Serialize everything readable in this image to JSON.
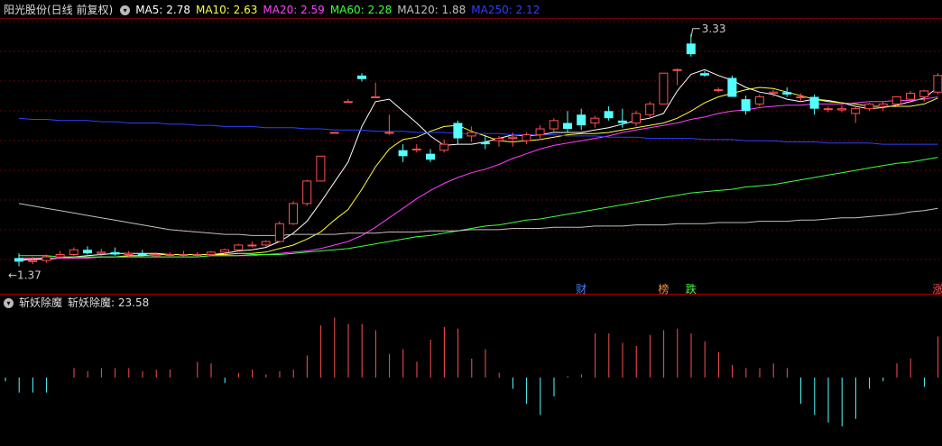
{
  "header": {
    "stock_title": "阳光股份(日线 前复权)",
    "ma5_label": "MA5: 2.78",
    "ma10_label": "MA10: 2.63",
    "ma20_label": "MA20: 2.59",
    "ma60_label": "MA60: 2.28",
    "ma120_label": "MA120: 1.88",
    "ma250_label": "MA250: 2.12"
  },
  "indicator": {
    "title": "斩妖除魔",
    "value_label": "斩妖除魔: 23.58"
  },
  "colors": {
    "background": "#000000",
    "up": "#ff5050",
    "down": "#54ffff",
    "ma5": "#ffffff",
    "ma10": "#ffff40",
    "ma20": "#ff40ff",
    "ma60": "#40ff40",
    "ma120": "#c0c0c0",
    "ma250": "#3040ff",
    "grid": "#6a0000"
  },
  "chart_data": [
    {
      "type": "candlestick",
      "title": "阳光股份(日线 前复权)",
      "ylim": [
        1.2,
        3.45
      ],
      "high_label": "3.33",
      "low_label": "1.37",
      "markers": [
        {
          "index": 41,
          "text": "财",
          "color": "#4080ff"
        },
        {
          "index": 47,
          "text": "榜",
          "color": "#ff9040"
        },
        {
          "index": 49,
          "text": "跌",
          "color": "#40ff40"
        },
        {
          "index": 67,
          "text": "涨",
          "color": "#ff5050"
        }
      ],
      "ohlc": [
        [
          1.44,
          1.48,
          1.37,
          1.41
        ],
        [
          1.41,
          1.45,
          1.39,
          1.42
        ],
        [
          1.42,
          1.47,
          1.4,
          1.45
        ],
        [
          1.45,
          1.5,
          1.43,
          1.47
        ],
        [
          1.47,
          1.53,
          1.46,
          1.51
        ],
        [
          1.51,
          1.54,
          1.47,
          1.48
        ],
        [
          1.48,
          1.52,
          1.45,
          1.49
        ],
        [
          1.49,
          1.53,
          1.46,
          1.47
        ],
        [
          1.47,
          1.5,
          1.45,
          1.48
        ],
        [
          1.48,
          1.51,
          1.46,
          1.46
        ],
        [
          1.46,
          1.49,
          1.44,
          1.47
        ],
        [
          1.47,
          1.49,
          1.45,
          1.47
        ],
        [
          1.47,
          1.5,
          1.45,
          1.47
        ],
        [
          1.47,
          1.49,
          1.45,
          1.47
        ],
        [
          1.47,
          1.5,
          1.46,
          1.49
        ],
        [
          1.49,
          1.52,
          1.47,
          1.51
        ],
        [
          1.51,
          1.56,
          1.5,
          1.55
        ],
        [
          1.55,
          1.58,
          1.53,
          1.55
        ],
        [
          1.55,
          1.59,
          1.54,
          1.58
        ],
        [
          1.58,
          1.75,
          1.57,
          1.73
        ],
        [
          1.73,
          1.92,
          1.72,
          1.9
        ],
        [
          1.9,
          2.1,
          1.88,
          2.09
        ],
        [
          2.09,
          2.3,
          2.09,
          2.3
        ],
        [
          2.5,
          2.5,
          2.5,
          2.5
        ],
        [
          2.76,
          2.78,
          2.76,
          2.76
        ],
        [
          2.98,
          3.0,
          2.93,
          2.95
        ],
        [
          2.8,
          2.92,
          2.8,
          2.8
        ],
        [
          2.5,
          2.65,
          2.48,
          2.5
        ],
        [
          2.35,
          2.4,
          2.25,
          2.3
        ],
        [
          2.36,
          2.4,
          2.33,
          2.36
        ],
        [
          2.32,
          2.36,
          2.25,
          2.27
        ],
        [
          2.35,
          2.44,
          2.33,
          2.4
        ],
        [
          2.58,
          2.6,
          2.4,
          2.45
        ],
        [
          2.47,
          2.55,
          2.42,
          2.5
        ],
        [
          2.42,
          2.48,
          2.36,
          2.4
        ],
        [
          2.43,
          2.47,
          2.38,
          2.45
        ],
        [
          2.45,
          2.5,
          2.38,
          2.46
        ],
        [
          2.43,
          2.5,
          2.4,
          2.48
        ],
        [
          2.48,
          2.56,
          2.45,
          2.53
        ],
        [
          2.53,
          2.62,
          2.5,
          2.6
        ],
        [
          2.58,
          2.68,
          2.5,
          2.53
        ],
        [
          2.65,
          2.7,
          2.52,
          2.56
        ],
        [
          2.58,
          2.64,
          2.54,
          2.62
        ],
        [
          2.68,
          2.72,
          2.6,
          2.62
        ],
        [
          2.6,
          2.7,
          2.54,
          2.58
        ],
        [
          2.58,
          2.68,
          2.55,
          2.66
        ],
        [
          2.65,
          2.76,
          2.62,
          2.74
        ],
        [
          2.74,
          3.0,
          2.74,
          3.0
        ],
        [
          3.03,
          3.04,
          2.9,
          3.03
        ],
        [
          3.25,
          3.33,
          3.14,
          3.16
        ],
        [
          3.0,
          3.02,
          2.97,
          2.98
        ],
        [
          2.86,
          2.88,
          2.84,
          2.86
        ],
        [
          2.96,
          2.98,
          2.8,
          2.8
        ],
        [
          2.78,
          2.81,
          2.65,
          2.68
        ],
        [
          2.74,
          2.82,
          2.72,
          2.8
        ],
        [
          2.83,
          2.86,
          2.8,
          2.84
        ],
        [
          2.84,
          2.88,
          2.8,
          2.82
        ],
        [
          2.8,
          2.83,
          2.76,
          2.8
        ],
        [
          2.8,
          2.82,
          2.65,
          2.7
        ],
        [
          2.7,
          2.72,
          2.67,
          2.7
        ],
        [
          2.69,
          2.73,
          2.67,
          2.7
        ],
        [
          2.66,
          2.72,
          2.58,
          2.7
        ],
        [
          2.7,
          2.75,
          2.68,
          2.74
        ],
        [
          2.72,
          2.76,
          2.68,
          2.74
        ],
        [
          2.74,
          2.8,
          2.72,
          2.8
        ],
        [
          2.78,
          2.85,
          2.75,
          2.83
        ],
        [
          2.8,
          2.86,
          2.76,
          2.85
        ],
        [
          2.84,
          3.0,
          2.82,
          2.98
        ]
      ],
      "series": [
        {
          "name": "MA5",
          "values": [
            1.42,
            1.43,
            1.43,
            1.44,
            1.45,
            1.46,
            1.47,
            1.48,
            1.48,
            1.48,
            1.48,
            1.47,
            1.47,
            1.47,
            1.47,
            1.48,
            1.5,
            1.51,
            1.53,
            1.58,
            1.65,
            1.75,
            1.91,
            2.08,
            2.25,
            2.55,
            2.76,
            2.78,
            2.68,
            2.58,
            2.47,
            2.39,
            2.4,
            2.4,
            2.42,
            2.45,
            2.48,
            2.47,
            2.48,
            2.5,
            2.5,
            2.5,
            2.52,
            2.54,
            2.57,
            2.6,
            2.62,
            2.66,
            2.85,
            2.99,
            3.03,
            2.98,
            2.94,
            2.88,
            2.84,
            2.82,
            2.78,
            2.76,
            2.78,
            2.77,
            2.75,
            2.72,
            2.7,
            2.71,
            2.73,
            2.76,
            2.79,
            2.88
          ]
        },
        {
          "name": "MA10",
          "values": [
            1.43,
            1.43,
            1.44,
            1.44,
            1.44,
            1.44,
            1.45,
            1.45,
            1.46,
            1.46,
            1.47,
            1.47,
            1.47,
            1.47,
            1.47,
            1.47,
            1.48,
            1.48,
            1.49,
            1.52,
            1.55,
            1.6,
            1.66,
            1.76,
            1.85,
            2.02,
            2.21,
            2.36,
            2.44,
            2.46,
            2.51,
            2.55,
            2.56,
            2.51,
            2.47,
            2.43,
            2.42,
            2.43,
            2.44,
            2.46,
            2.48,
            2.49,
            2.49,
            2.5,
            2.52,
            2.54,
            2.56,
            2.58,
            2.62,
            2.68,
            2.75,
            2.8,
            2.83,
            2.86,
            2.88,
            2.87,
            2.84,
            2.81,
            2.78,
            2.76,
            2.75,
            2.74,
            2.72,
            2.72,
            2.72,
            2.72,
            2.74,
            2.79
          ]
        },
        {
          "name": "MA20",
          "values": [
            1.44,
            1.44,
            1.44,
            1.44,
            1.44,
            1.44,
            1.45,
            1.45,
            1.45,
            1.45,
            1.45,
            1.45,
            1.45,
            1.45,
            1.46,
            1.46,
            1.46,
            1.46,
            1.47,
            1.48,
            1.49,
            1.5,
            1.52,
            1.55,
            1.58,
            1.63,
            1.7,
            1.78,
            1.86,
            1.94,
            2.01,
            2.07,
            2.12,
            2.16,
            2.19,
            2.23,
            2.28,
            2.32,
            2.36,
            2.39,
            2.41,
            2.43,
            2.45,
            2.47,
            2.5,
            2.52,
            2.54,
            2.56,
            2.58,
            2.61,
            2.63,
            2.66,
            2.68,
            2.69,
            2.71,
            2.72,
            2.73,
            2.73,
            2.74,
            2.74,
            2.74,
            2.75,
            2.76,
            2.76,
            2.77,
            2.77,
            2.78,
            2.8
          ]
        },
        {
          "name": "MA60",
          "values": [
            1.46,
            1.46,
            1.46,
            1.45,
            1.45,
            1.45,
            1.45,
            1.45,
            1.45,
            1.45,
            1.45,
            1.45,
            1.45,
            1.45,
            1.46,
            1.46,
            1.46,
            1.47,
            1.47,
            1.47,
            1.48,
            1.49,
            1.5,
            1.51,
            1.52,
            1.54,
            1.56,
            1.58,
            1.6,
            1.62,
            1.63,
            1.65,
            1.67,
            1.69,
            1.71,
            1.72,
            1.74,
            1.76,
            1.77,
            1.79,
            1.81,
            1.83,
            1.85,
            1.87,
            1.89,
            1.91,
            1.93,
            1.95,
            1.97,
            1.99,
            2.0,
            2.01,
            2.02,
            2.04,
            2.05,
            2.06,
            2.08,
            2.1,
            2.12,
            2.14,
            2.16,
            2.18,
            2.2,
            2.22,
            2.24,
            2.25,
            2.27,
            2.29
          ]
        },
        {
          "name": "MA120",
          "values": [
            1.9,
            1.88,
            1.86,
            1.84,
            1.82,
            1.8,
            1.78,
            1.76,
            1.74,
            1.72,
            1.7,
            1.68,
            1.67,
            1.66,
            1.65,
            1.64,
            1.64,
            1.63,
            1.63,
            1.63,
            1.64,
            1.64,
            1.64,
            1.64,
            1.65,
            1.65,
            1.65,
            1.66,
            1.66,
            1.66,
            1.67,
            1.67,
            1.67,
            1.68,
            1.68,
            1.68,
            1.69,
            1.69,
            1.69,
            1.7,
            1.7,
            1.7,
            1.71,
            1.71,
            1.71,
            1.72,
            1.72,
            1.72,
            1.73,
            1.73,
            1.73,
            1.74,
            1.74,
            1.74,
            1.75,
            1.75,
            1.75,
            1.76,
            1.76,
            1.77,
            1.78,
            1.78,
            1.79,
            1.8,
            1.81,
            1.83,
            1.84,
            1.86
          ]
        },
        {
          "name": "MA250",
          "values": [
            2.62,
            2.61,
            2.61,
            2.6,
            2.6,
            2.6,
            2.59,
            2.59,
            2.58,
            2.58,
            2.58,
            2.57,
            2.57,
            2.56,
            2.56,
            2.55,
            2.55,
            2.55,
            2.54,
            2.54,
            2.54,
            2.53,
            2.53,
            2.52,
            2.52,
            2.52,
            2.51,
            2.51,
            2.51,
            2.5,
            2.5,
            2.5,
            2.49,
            2.49,
            2.49,
            2.49,
            2.48,
            2.48,
            2.48,
            2.48,
            2.47,
            2.47,
            2.47,
            2.46,
            2.46,
            2.46,
            2.45,
            2.45,
            2.45,
            2.45,
            2.44,
            2.44,
            2.44,
            2.43,
            2.43,
            2.43,
            2.42,
            2.42,
            2.42,
            2.41,
            2.41,
            2.41,
            2.41,
            2.4,
            2.4,
            2.4,
            2.4,
            2.4
          ]
        }
      ]
    },
    {
      "type": "bar",
      "title": "斩妖除魔",
      "ylim": [
        -24,
        40
      ],
      "values": [
        -2,
        -8,
        -8,
        -8,
        0,
        6,
        4,
        6,
        6,
        6,
        4,
        5,
        5,
        0,
        10,
        9,
        -3,
        3,
        5,
        2,
        4,
        5,
        14,
        33,
        38,
        34,
        34,
        30,
        15,
        18,
        10,
        24,
        32,
        31,
        12,
        18,
        3,
        -6,
        -14,
        -20,
        -10,
        1,
        2,
        28,
        28,
        22,
        20,
        27,
        30,
        31,
        28,
        23,
        16,
        8,
        6,
        6,
        9,
        6,
        -14,
        -20,
        -24,
        -26,
        -22,
        -6,
        -2,
        9,
        12,
        -5,
        26
      ]
    }
  ]
}
